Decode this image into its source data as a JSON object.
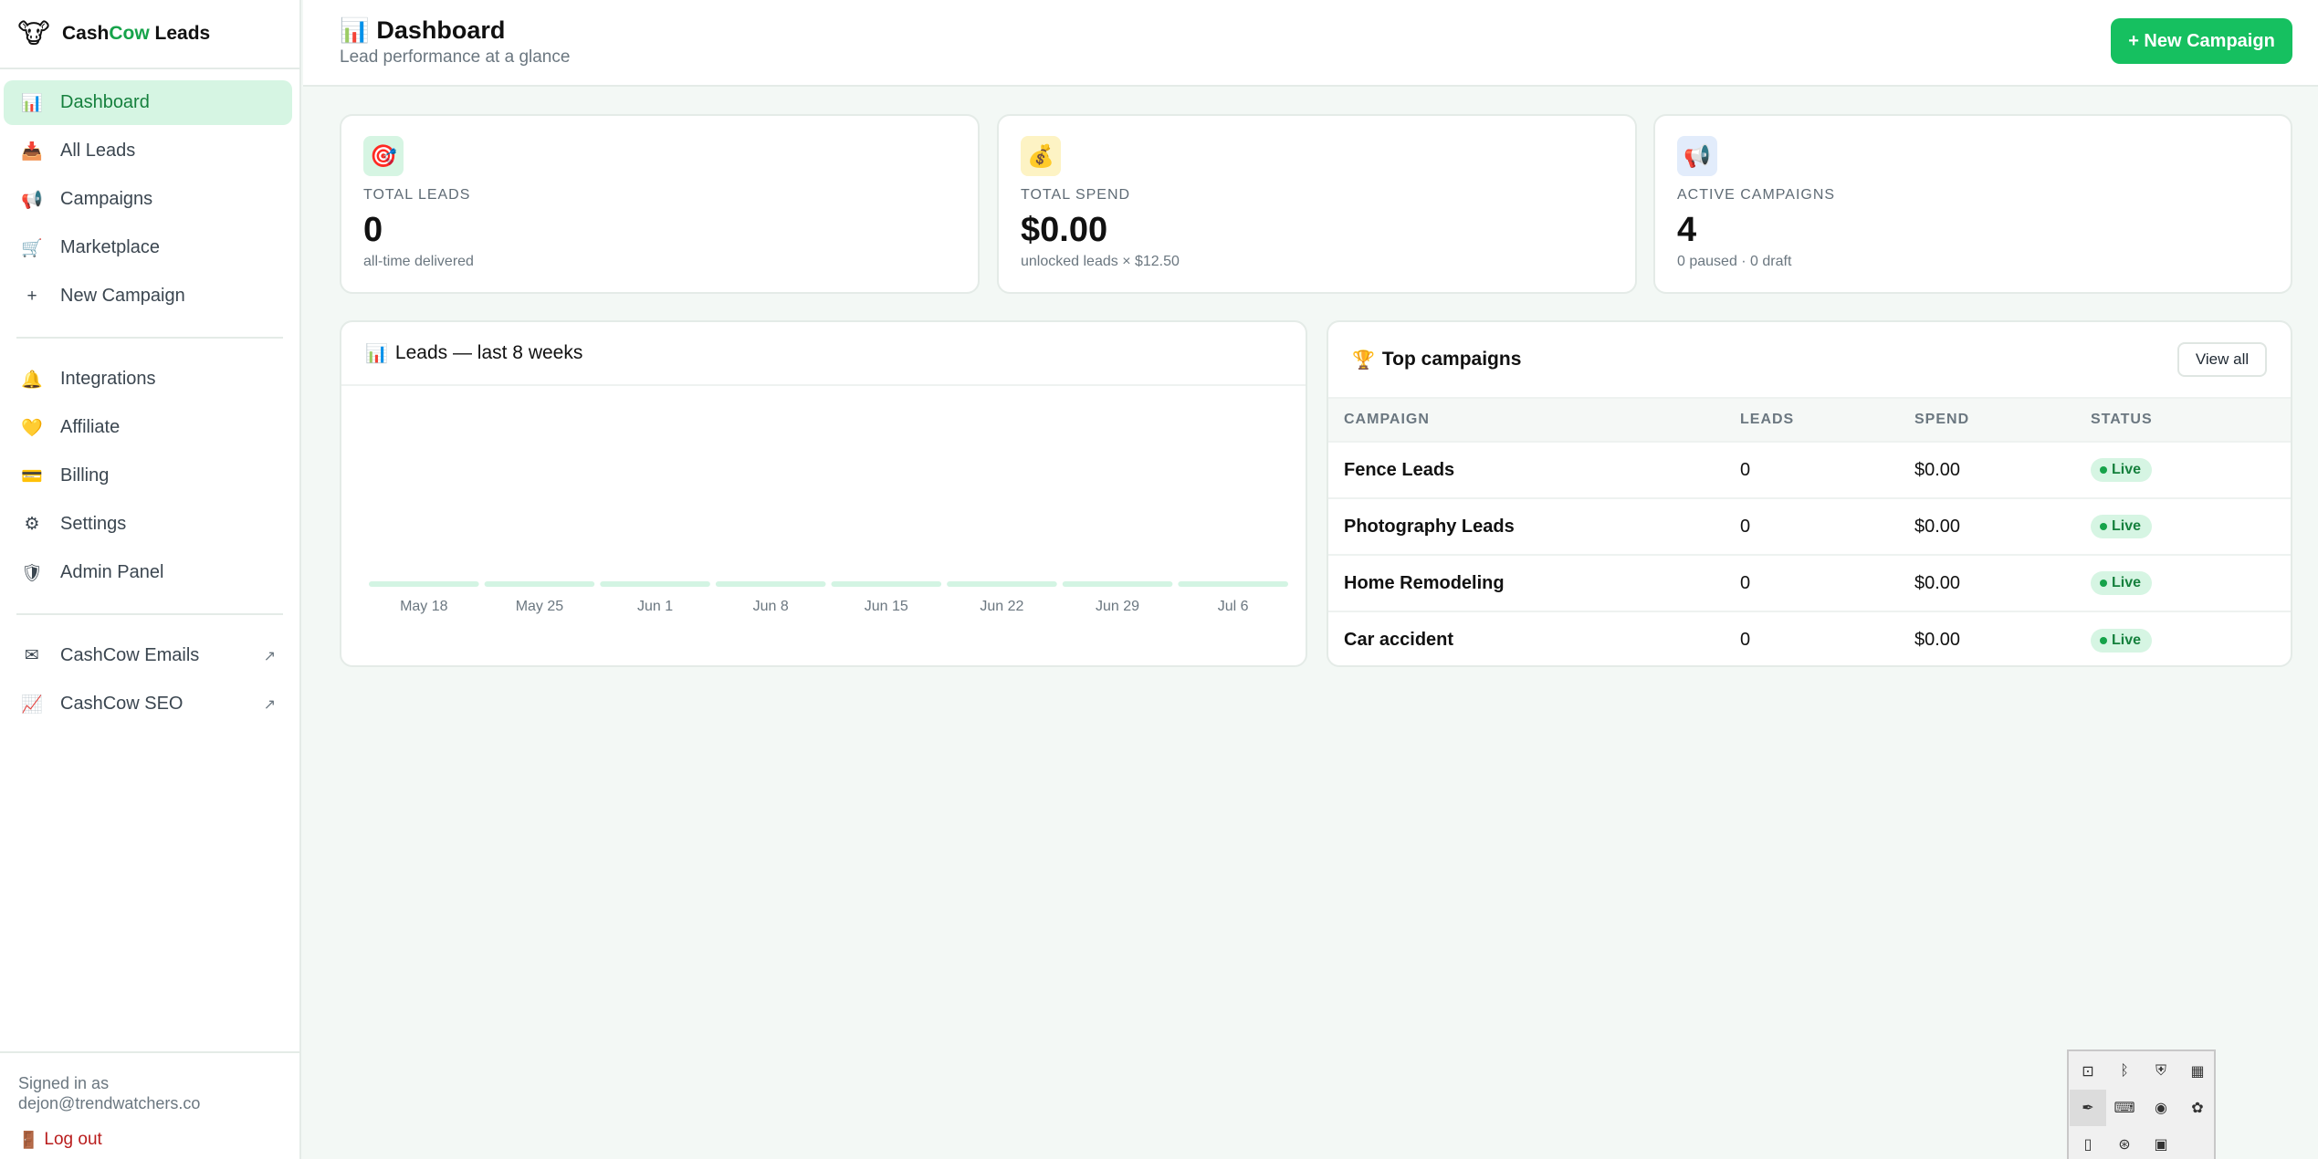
{
  "brand": {
    "logo_icon": "🐮",
    "name_part1": "Cash",
    "name_part2": "Cow",
    "name_part3": " Leads",
    "accent": "#16a34a"
  },
  "sidebar": {
    "items": [
      {
        "icon": "📊",
        "label": "Dashboard",
        "active": true
      },
      {
        "icon": "📥",
        "label": "All Leads"
      },
      {
        "icon": "📢",
        "label": "Campaigns"
      },
      {
        "icon": "🛒",
        "label": "Marketplace"
      },
      {
        "icon": "+",
        "label": "New Campaign"
      }
    ],
    "items2": [
      {
        "icon": "🔔",
        "label": "Integrations"
      },
      {
        "icon": "💛",
        "label": "Affiliate"
      },
      {
        "icon": "💳",
        "label": "Billing"
      },
      {
        "icon": "⚙",
        "label": "Settings"
      },
      {
        "icon": "🛡",
        "label": "Admin Panel"
      }
    ],
    "external": [
      {
        "icon": "✉",
        "label": "CashCow Emails",
        "ext": "↗"
      },
      {
        "icon": "📈",
        "label": "CashCow SEO",
        "ext": "↗"
      }
    ],
    "footer": {
      "signed_in_as": "Signed in as",
      "email": "dejon@trendwatchers.co",
      "logout_icon": "🚪",
      "logout": "Log out"
    }
  },
  "header": {
    "title_icon": "📊",
    "title": "Dashboard",
    "subtitle": "Lead performance at a glance",
    "new_campaign": "+ New Campaign"
  },
  "stats": [
    {
      "icon": "🎯",
      "label": "TOTAL LEADS",
      "value": "0",
      "sub": "all-time delivered",
      "bg": "#d6f5e3"
    },
    {
      "icon": "💰",
      "label": "TOTAL SPEND",
      "value": "$0.00",
      "sub": "unlocked leads × $12.50",
      "bg": "#fdf3c4"
    },
    {
      "icon": "📢",
      "label": "ACTIVE CAMPAIGNS",
      "value": "4",
      "sub": "0 paused · 0 draft",
      "bg": "#e2ecfb"
    }
  ],
  "chart": {
    "title_icon": "📊",
    "title": "Leads — last 8 weeks",
    "bar_color": "#d3f4e3"
  },
  "chart_data": {
    "type": "bar",
    "title": "Leads — last 8 weeks",
    "categories": [
      "May 18",
      "May 25",
      "Jun 1",
      "Jun 8",
      "Jun 15",
      "Jun 22",
      "Jun 29",
      "Jul 6"
    ],
    "values": [
      0,
      0,
      0,
      0,
      0,
      0,
      0,
      0
    ],
    "xlabel": "",
    "ylabel": "",
    "grid": false
  },
  "top_campaigns": {
    "title_icon": "🏆",
    "title": "Top campaigns",
    "view_all": "View all",
    "columns": [
      "CAMPAIGN",
      "LEADS",
      "SPEND",
      "STATUS"
    ],
    "rows": [
      {
        "name": "Fence Leads",
        "leads": "0",
        "spend": "$0.00",
        "status": "Live"
      },
      {
        "name": "Photography Leads",
        "leads": "0",
        "spend": "$0.00",
        "status": "Live"
      },
      {
        "name": "Home Remodeling",
        "leads": "0",
        "spend": "$0.00",
        "status": "Live"
      },
      {
        "name": "Car accident",
        "leads": "0",
        "spend": "$0.00",
        "status": "Live"
      }
    ]
  },
  "tray": {
    "icons": [
      {
        "name": "plug-icon",
        "glyph": "⊡"
      },
      {
        "name": "bluetooth-icon",
        "glyph": "ᛒ"
      },
      {
        "name": "shield-tray-icon",
        "glyph": "⛨"
      },
      {
        "name": "app-tray-icon",
        "glyph": "▦"
      },
      {
        "name": "pen-icon",
        "glyph": "✒"
      },
      {
        "name": "gamepad-icon",
        "glyph": "⌨"
      },
      {
        "name": "steam-icon",
        "glyph": "◉"
      },
      {
        "name": "palette-icon",
        "glyph": "✿"
      },
      {
        "name": "usb-icon",
        "glyph": "▯"
      },
      {
        "name": "chatgpt-icon",
        "glyph": "⊛"
      },
      {
        "name": "calendar-tray-icon",
        "glyph": "▣"
      }
    ]
  }
}
